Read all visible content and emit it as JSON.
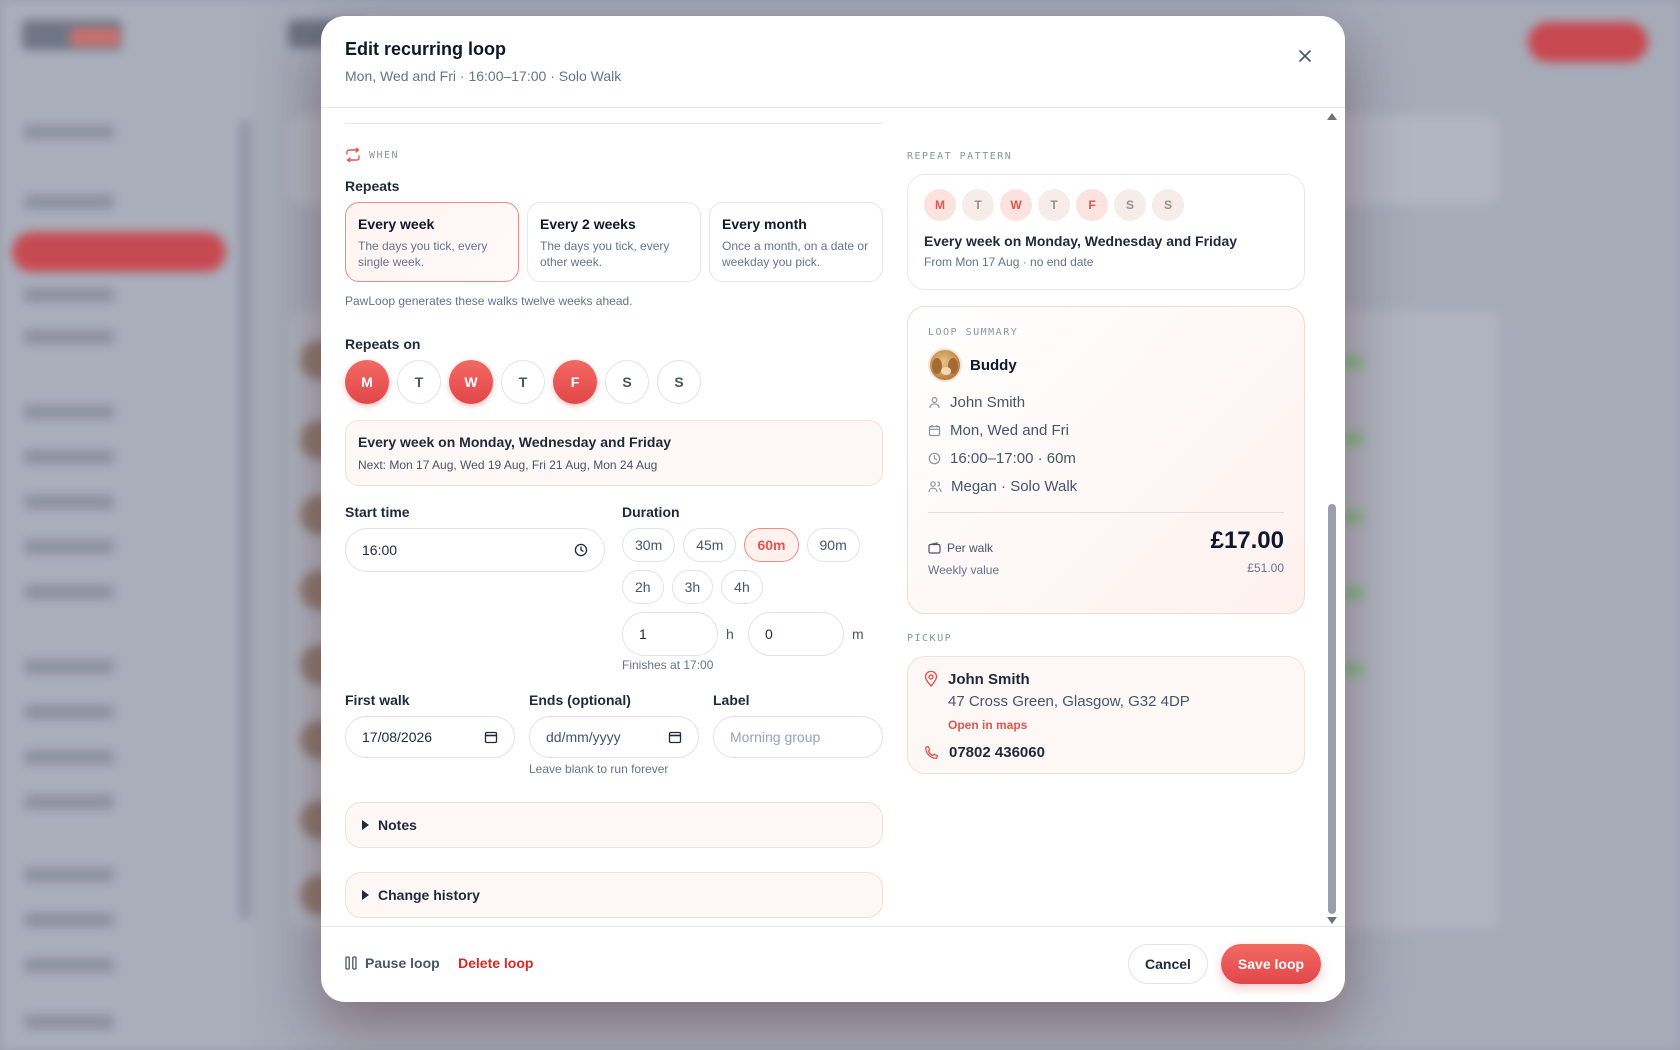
{
  "modal": {
    "title": "Edit recurring loop",
    "subtitle": "Mon, Wed and Fri · 16:00–17:00 · Solo Walk"
  },
  "icons": {
    "close": "close-icon",
    "repeat": "repeat-icon",
    "clock": "clock-icon",
    "calendar": "calendar-icon",
    "person": "person-icon",
    "people": "people-icon",
    "wallet": "wallet-icon",
    "pin": "map-pin-icon",
    "phone": "phone-icon",
    "pause": "pause-icon"
  },
  "colors": {
    "accent": "#e2554e",
    "danger": "#dc2626"
  },
  "when": {
    "section_label": "WHEN",
    "repeats_label": "Repeats",
    "options": [
      {
        "title": "Every week",
        "desc": "The days you tick, every single week.",
        "selected": true
      },
      {
        "title": "Every 2 weeks",
        "desc": "The days you tick, every other week.",
        "selected": false
      },
      {
        "title": "Every month",
        "desc": "Once a month, on a date or weekday you pick.",
        "selected": false
      }
    ],
    "hint": "PawLoop generates these walks twelve weeks ahead.",
    "repeats_on_label": "Repeats on",
    "days": [
      {
        "label": "M",
        "on": true
      },
      {
        "label": "T",
        "on": false
      },
      {
        "label": "W",
        "on": true
      },
      {
        "label": "T",
        "on": false
      },
      {
        "label": "F",
        "on": true
      },
      {
        "label": "S",
        "on": false
      },
      {
        "label": "S",
        "on": false
      }
    ],
    "summary_title": "Every week on Monday, Wednesday and Friday",
    "summary_next": "Next: Mon 17 Aug, Wed 19 Aug, Fri 21 Aug, Mon 24 Aug"
  },
  "time": {
    "start_label": "Start time",
    "start_value": "16:00",
    "duration_label": "Duration",
    "durations_row1": [
      {
        "label": "30m",
        "on": false
      },
      {
        "label": "45m",
        "on": false
      },
      {
        "label": "60m",
        "on": true
      },
      {
        "label": "90m",
        "on": false
      }
    ],
    "durations_row2": [
      {
        "label": "2h",
        "on": false
      },
      {
        "label": "3h",
        "on": false
      },
      {
        "label": "4h",
        "on": false
      }
    ],
    "hours_value": "1",
    "hours_unit": "h",
    "minutes_value": "0",
    "minutes_unit": "m",
    "finishes": "Finishes at 17:00"
  },
  "dates": {
    "first_label": "First walk",
    "first_value": "17/08/2026",
    "ends_label": "Ends (optional)",
    "ends_placeholder": "dd/mm/yyyy",
    "ends_hint": "Leave blank to run forever",
    "label_label": "Label",
    "label_placeholder": "Morning group"
  },
  "collapsibles": {
    "notes": "Notes",
    "history": "Change history"
  },
  "pattern": {
    "section_label": "REPEAT PATTERN",
    "days": [
      {
        "label": "M",
        "on": true
      },
      {
        "label": "T",
        "on": false
      },
      {
        "label": "W",
        "on": true
      },
      {
        "label": "T",
        "on": false
      },
      {
        "label": "F",
        "on": true
      },
      {
        "label": "S",
        "on": false
      },
      {
        "label": "S",
        "on": false
      }
    ],
    "title": "Every week on Monday, Wednesday and Friday",
    "sub": "From Mon 17 Aug · no end date"
  },
  "loop_summary": {
    "section_label": "LOOP SUMMARY",
    "pet_name": "Buddy",
    "owner": "John Smith",
    "days": "Mon, Wed and Fri",
    "time": "16:00–17:00 · 60m",
    "walker": "Megan · Solo Walk",
    "per_walk_label": "Per walk",
    "price": "£17.00",
    "weekly_label": "Weekly value",
    "weekly_value": "£51.00"
  },
  "pickup": {
    "section_label": "PICKUP",
    "name": "John Smith",
    "address": "47 Cross Green, Glasgow, G32 4DP",
    "maps_link": "Open in maps",
    "phone": "07802 436060"
  },
  "footer": {
    "pause": "Pause loop",
    "delete": "Delete loop",
    "cancel": "Cancel",
    "save": "Save loop"
  }
}
